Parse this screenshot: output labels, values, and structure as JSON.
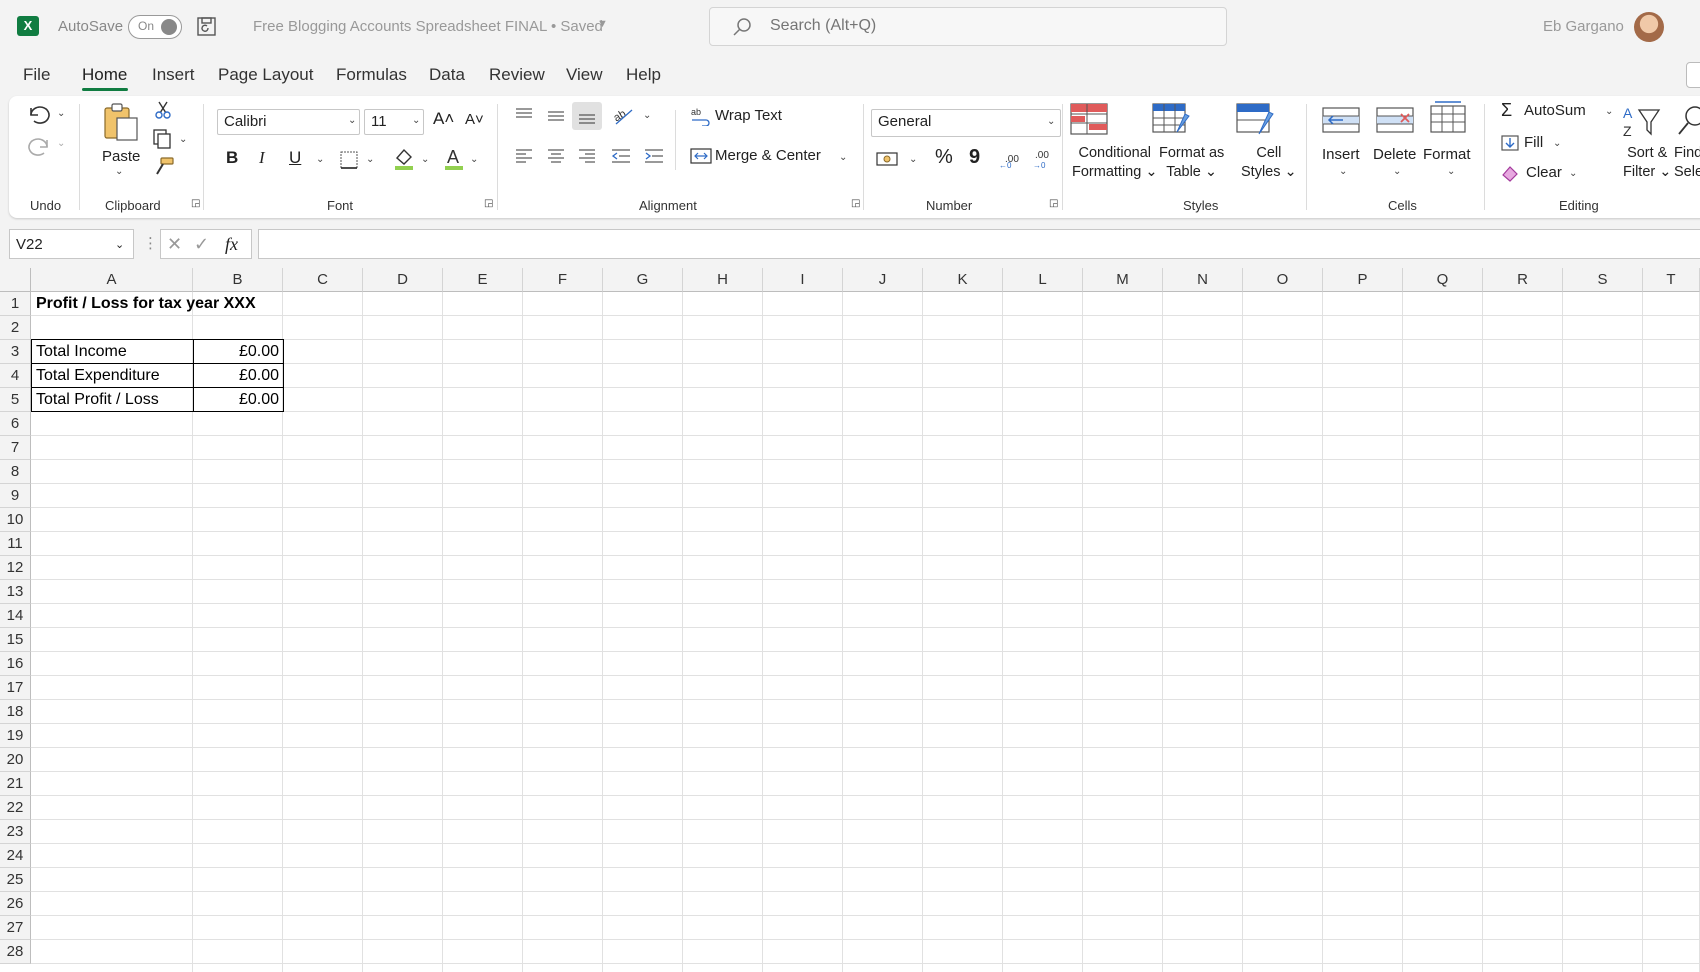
{
  "titlebar": {
    "app_logo": "X",
    "autosave_label": "AutoSave",
    "autosave_state": "On",
    "doc_title": "Free Blogging Accounts Spreadsheet FINAL • Saved",
    "search_placeholder": "Search (Alt+Q)",
    "user_name": "Eb Gargano"
  },
  "menu": {
    "tabs": [
      "File",
      "Home",
      "Insert",
      "Page Layout",
      "Formulas",
      "Data",
      "Review",
      "View",
      "Help"
    ],
    "active": "Home"
  },
  "ribbon": {
    "groups": {
      "undo": "Undo",
      "clipboard": "Clipboard",
      "font": "Font",
      "alignment": "Alignment",
      "number": "Number",
      "styles": "Styles",
      "cells": "Cells",
      "editing": "Editing"
    },
    "paste_label": "Paste",
    "font_name": "Calibri",
    "font_size": "11",
    "bold": "B",
    "italic": "I",
    "underline": "U",
    "wrap_text": "Wrap Text",
    "merge_center": "Merge & Center",
    "number_format": "General",
    "percent": "%",
    "comma": "9",
    "conditional_formatting": [
      "Conditional",
      "Formatting"
    ],
    "format_as_table": [
      "Format as",
      "Table"
    ],
    "cell_styles": [
      "Cell",
      "Styles"
    ],
    "insert": "Insert",
    "delete": "Delete",
    "format": "Format",
    "autosum": "AutoSum",
    "fill": "Fill",
    "clear": "Clear",
    "sort_filter": [
      "Sort &",
      "Filter"
    ],
    "find_select": [
      "Find",
      "Sele"
    ]
  },
  "formula_bar": {
    "name_box": "V22",
    "fx": "fx",
    "formula": ""
  },
  "sheet": {
    "columns": [
      "A",
      "B",
      "C",
      "D",
      "E",
      "F",
      "G",
      "H",
      "I",
      "J",
      "K",
      "L",
      "M",
      "N",
      "O",
      "P",
      "Q",
      "R",
      "S",
      "T"
    ],
    "rows": [
      "1",
      "2",
      "3",
      "4",
      "5",
      "6",
      "7",
      "8",
      "9",
      "10",
      "11",
      "12",
      "13",
      "14",
      "15",
      "16",
      "17",
      "18",
      "19",
      "20",
      "21",
      "22",
      "23",
      "24",
      "25",
      "26",
      "27",
      "28"
    ],
    "cells": {
      "A1": "Profit / Loss for tax year XXX",
      "A3": "Total Income",
      "B3": "£0.00",
      "A4": "Total Expenditure",
      "B4": "£0.00",
      "A5": "Total Profit / Loss",
      "B5": "£0.00"
    }
  }
}
